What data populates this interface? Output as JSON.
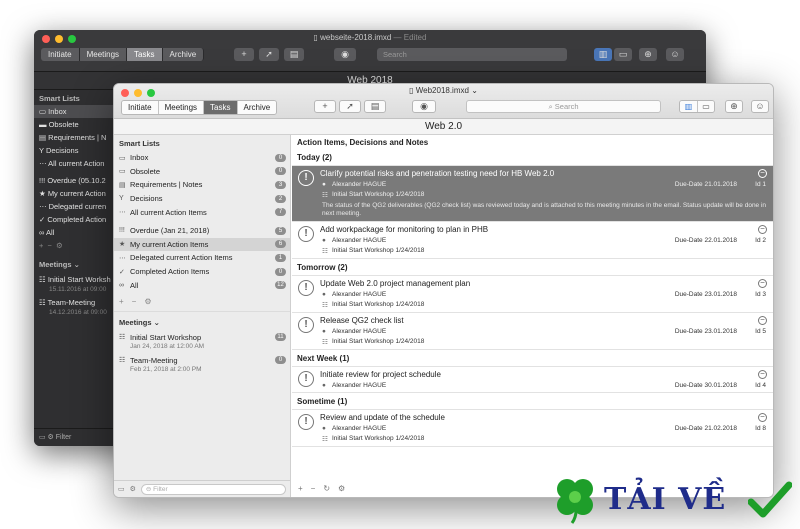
{
  "back_window": {
    "title": "webseite-2018.imxd",
    "edited": "— Edited",
    "tabs": [
      "Initiate",
      "Meetings",
      "Tasks",
      "Archive"
    ],
    "active_tab": "Tasks",
    "search_placeholder": "Search",
    "header": "Web 2018",
    "smart_lists_label": "Smart Lists",
    "smart_lists": [
      "Inbox",
      "Obsolete",
      "Requirements | N",
      "Decisions",
      "All current Action",
      "Overdue (05.10.2",
      "My current Action",
      "Delegated curren",
      "Completed Action",
      "All"
    ],
    "meetings_label": "Meetings",
    "meetings": [
      {
        "name": "Initial Start Worksh",
        "date": "15.11.2016 at 09:00"
      },
      {
        "name": "Team-Meeting",
        "date": "14.12.2016 at 09:00"
      }
    ],
    "filter_placeholder": "Filter"
  },
  "window": {
    "title": "Web2018.imxd",
    "tabs": [
      "Initiate",
      "Meetings",
      "Tasks",
      "Archive"
    ],
    "active_tab": "Tasks",
    "search_placeholder": "Search",
    "header": "Web 2.0"
  },
  "sidebar": {
    "smart_lists_label": "Smart Lists",
    "items": [
      {
        "icon": "inbox-icon",
        "glyph": "▭",
        "label": "Inbox",
        "count": "0"
      },
      {
        "icon": "obsolete-icon",
        "glyph": "▭",
        "label": "Obsolete",
        "count": "0"
      },
      {
        "icon": "requirements-icon",
        "glyph": "▤",
        "label": "Requirements | Notes",
        "count": "3"
      },
      {
        "icon": "decisions-icon",
        "glyph": "Y",
        "label": "Decisions",
        "count": "2"
      },
      {
        "icon": "all-current-icon",
        "glyph": "⋯",
        "label": "All current Action Items",
        "count": "7"
      },
      {
        "icon": "overdue-icon",
        "glyph": "!!!",
        "label": "Overdue (Jan 21, 2018)",
        "count": "5"
      },
      {
        "icon": "star-icon",
        "glyph": "★",
        "label": "My current Action Items",
        "count": "6",
        "selected": true
      },
      {
        "icon": "delegated-icon",
        "glyph": "⋯",
        "label": "Delegated current Action Items",
        "count": "1"
      },
      {
        "icon": "check-icon",
        "glyph": "✓",
        "label": "Completed Action Items",
        "count": "0"
      },
      {
        "icon": "infinity-icon",
        "glyph": "∞",
        "label": "All",
        "count": "12"
      }
    ],
    "meetings_label": "Meetings",
    "meetings": [
      {
        "name": "Initial Start Workshop",
        "date": "Jan 24, 2018 at 12:00 AM",
        "count": "11"
      },
      {
        "name": "Team-Meeting",
        "date": "Feb 21, 2018 at 2:00 PM",
        "count": "0"
      }
    ],
    "filter_placeholder": "Filter"
  },
  "content": {
    "heading": "Action Items, Decisions and Notes",
    "groups": [
      {
        "label": "Today (2)",
        "items": [
          {
            "title": "Clarify potential risks and penetration testing need for HB Web 2.0",
            "person": "Alexander HAGUE",
            "meeting": "Initial Start Workshop 1/24/2018",
            "due": "Due-Date 21.01.2018",
            "id": "Id 1",
            "note": "The status of the QG2 deliverables (QG2 check list) was reviewed today and is attached to this meeting minutes in the email. Status update will be done in next meeting.",
            "selected": true
          },
          {
            "title": "Add workpackage for monitoring to plan in PHB",
            "person": "Alexander HAGUE",
            "meeting": "Initial Start Workshop 1/24/2018",
            "due": "Due-Date 22.01.2018",
            "id": "Id 2",
            "note": ""
          }
        ]
      },
      {
        "label": "Tomorrow (2)",
        "items": [
          {
            "title": "Update Web 2.0 project management plan",
            "person": "Alexander HAGUE",
            "meeting": "Initial Start Workshop 1/24/2018",
            "due": "Due-Date 23.01.2018",
            "id": "Id 3",
            "note": ""
          },
          {
            "title": "Release QG2 check list",
            "person": "Alexander HAGUE",
            "meeting": "Initial Start Workshop 1/24/2018",
            "due": "Due-Date 23.01.2018",
            "id": "Id 5",
            "note": ""
          }
        ]
      },
      {
        "label": "Next Week (1)",
        "items": [
          {
            "title": "Initiate review for project schedule",
            "person": "Alexander HAGUE",
            "meeting": "",
            "due": "Due-Date 30.01.2018",
            "id": "Id 4",
            "note": ""
          }
        ]
      },
      {
        "label": "Sometime (1)",
        "items": [
          {
            "title": "Review and update of the schedule",
            "person": "Alexander HAGUE",
            "meeting": "Initial Start Workshop 1/24/2018",
            "due": "Due-Date 21.02.2018",
            "id": "Id 8",
            "note": ""
          }
        ]
      }
    ]
  },
  "watermark": {
    "text": "TẢI VỀ"
  },
  "colors": {
    "close": "#ff5f57",
    "minimize": "#febc2e",
    "zoom": "#28c840",
    "selection": "#7a7a7a",
    "watermark": "#1f2c8a",
    "clover": "#1e9e2a"
  }
}
